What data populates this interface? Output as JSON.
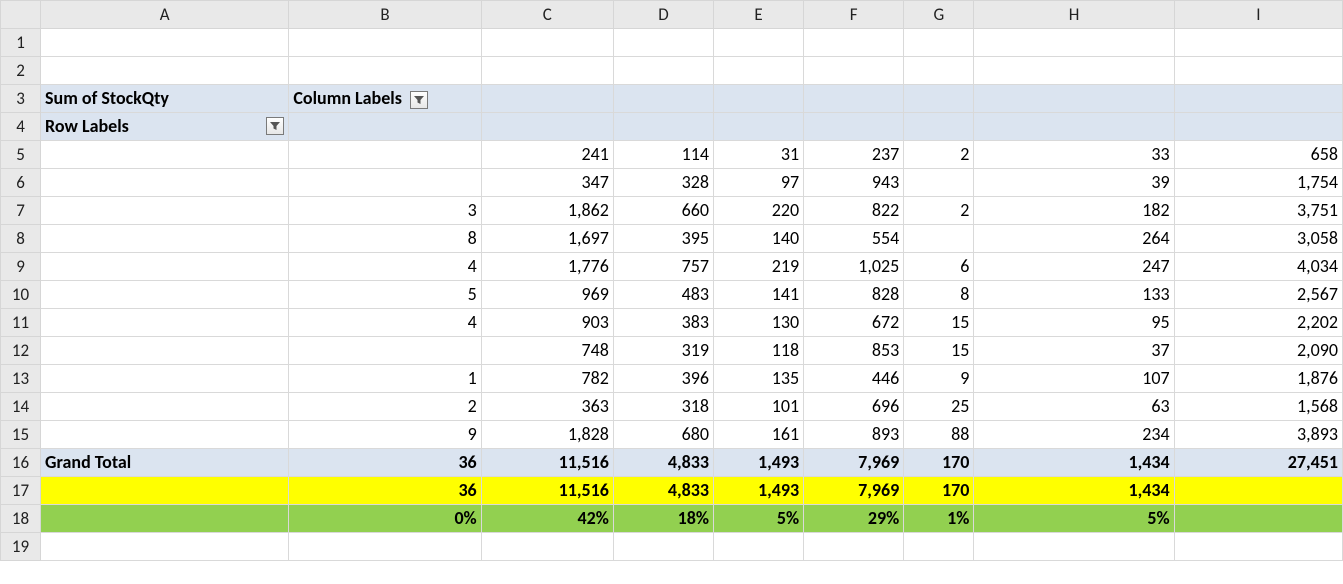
{
  "columns": [
    "A",
    "B",
    "C",
    "D",
    "E",
    "F",
    "G",
    "H",
    "I"
  ],
  "row_numbers": [
    "1",
    "2",
    "3",
    "4",
    "5",
    "6",
    "7",
    "8",
    "9",
    "10",
    "11",
    "12",
    "13",
    "14",
    "15",
    "16",
    "17",
    "18",
    "19"
  ],
  "pivot": {
    "measure_label": "Sum of StockQty",
    "column_labels_label": "Column Labels",
    "row_labels_label": "Row Labels",
    "grand_total_label": "Grand Total"
  },
  "rows": [
    {
      "B": "",
      "C": "241",
      "D": "114",
      "E": "31",
      "F": "237",
      "G": "2",
      "H": "33",
      "I": "658"
    },
    {
      "B": "",
      "C": "347",
      "D": "328",
      "E": "97",
      "F": "943",
      "G": "",
      "H": "39",
      "I": "1,754"
    },
    {
      "B": "3",
      "C": "1,862",
      "D": "660",
      "E": "220",
      "F": "822",
      "G": "2",
      "H": "182",
      "I": "3,751"
    },
    {
      "B": "8",
      "C": "1,697",
      "D": "395",
      "E": "140",
      "F": "554",
      "G": "",
      "H": "264",
      "I": "3,058"
    },
    {
      "B": "4",
      "C": "1,776",
      "D": "757",
      "E": "219",
      "F": "1,025",
      "G": "6",
      "H": "247",
      "I": "4,034"
    },
    {
      "B": "5",
      "C": "969",
      "D": "483",
      "E": "141",
      "F": "828",
      "G": "8",
      "H": "133",
      "I": "2,567"
    },
    {
      "B": "4",
      "C": "903",
      "D": "383",
      "E": "130",
      "F": "672",
      "G": "15",
      "H": "95",
      "I": "2,202"
    },
    {
      "B": "",
      "C": "748",
      "D": "319",
      "E": "118",
      "F": "853",
      "G": "15",
      "H": "37",
      "I": "2,090"
    },
    {
      "B": "1",
      "C": "782",
      "D": "396",
      "E": "135",
      "F": "446",
      "G": "9",
      "H": "107",
      "I": "1,876"
    },
    {
      "B": "2",
      "C": "363",
      "D": "318",
      "E": "101",
      "F": "696",
      "G": "25",
      "H": "63",
      "I": "1,568"
    },
    {
      "B": "9",
      "C": "1,828",
      "D": "680",
      "E": "161",
      "F": "893",
      "G": "88",
      "H": "234",
      "I": "3,893"
    }
  ],
  "grand_total": {
    "B": "36",
    "C": "11,516",
    "D": "4,833",
    "E": "1,493",
    "F": "7,969",
    "G": "170",
    "H": "1,434",
    "I": "27,451"
  },
  "copy_row": {
    "B": "36",
    "C": "11,516",
    "D": "4,833",
    "E": "1,493",
    "F": "7,969",
    "G": "170",
    "H": "1,434",
    "I": ""
  },
  "pct_row": {
    "B": "0%",
    "C": "42%",
    "D": "18%",
    "E": "5%",
    "F": "29%",
    "G": "1%",
    "H": "5%",
    "I": ""
  },
  "icons": {
    "filter": "filter-icon"
  }
}
